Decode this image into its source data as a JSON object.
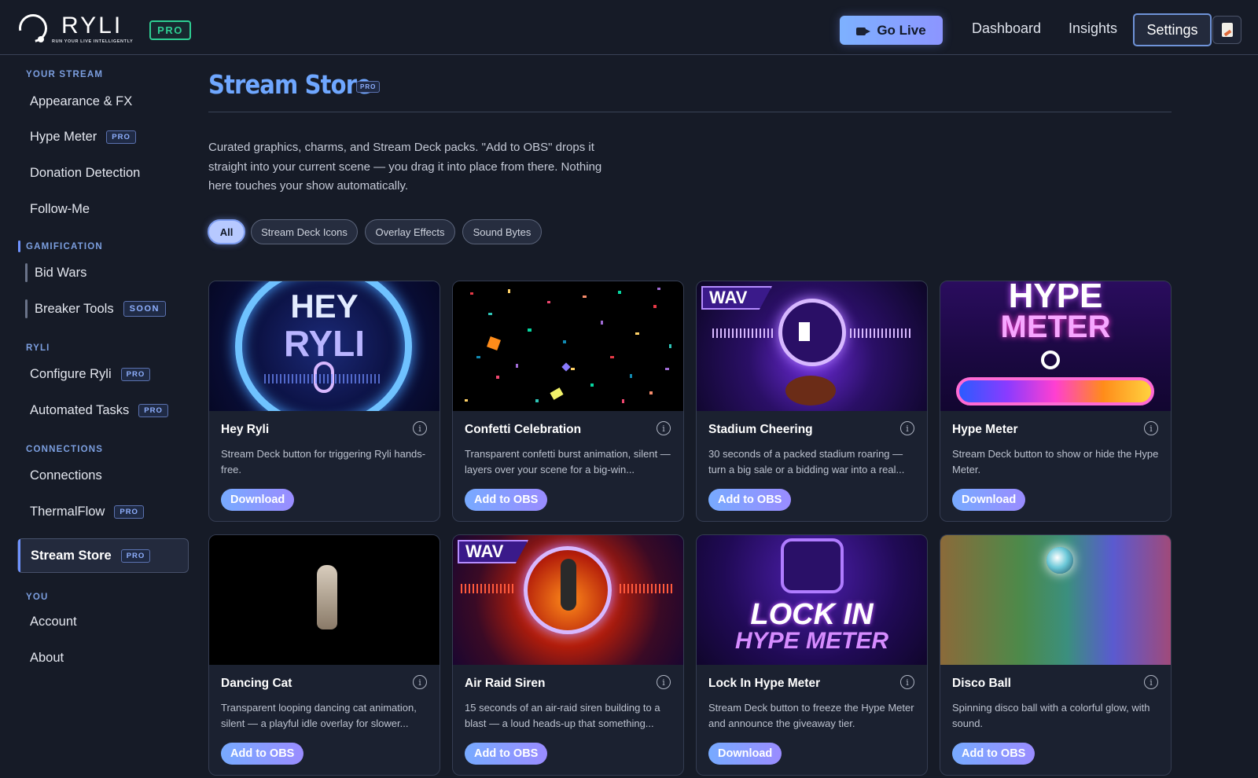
{
  "brand": {
    "name": "RYLI",
    "tagline": "RUN YOUR LIVE INTELLIGENTLY",
    "plan_badge": "PRO"
  },
  "header": {
    "go_live_label": "Go Live",
    "nav": {
      "dashboard": "Dashboard",
      "insights": "Insights",
      "settings": "Settings"
    },
    "accent_color": "#7db1ff"
  },
  "sidebar": {
    "sections": {
      "your_stream": "YOUR STREAM",
      "gamification": "GAMIFICATION",
      "ryli": "RYLI",
      "connections": "CONNECTIONS",
      "you": "YOU"
    },
    "items": {
      "appearance": "Appearance & FX",
      "hype_meter": "Hype Meter",
      "donation_detection": "Donation Detection",
      "follow_me": "Follow-Me",
      "bid_wars": "Bid Wars",
      "breaker_tools": "Breaker Tools",
      "configure_ryli": "Configure Ryli",
      "automated_tasks": "Automated Tasks",
      "connections": "Connections",
      "thermalflow": "ThermalFlow",
      "stream_store": "Stream Store",
      "account": "Account",
      "about": "About"
    },
    "badges": {
      "pro": "PRO",
      "soon": "SOON"
    },
    "active_item": "Stream Store"
  },
  "main": {
    "title": "Stream Store",
    "title_badge": "PRO",
    "intro": "Curated graphics, charms, and Stream Deck packs. \"Add to OBS\" drops it straight into your current scene — you drag it into place from there. Nothing here touches your show automatically.",
    "filters": [
      "All",
      "Stream Deck Icons",
      "Overlay Effects",
      "Sound Bytes"
    ],
    "active_filter": "All",
    "cards": [
      {
        "title": "Hey Ryli",
        "desc": "Stream Deck button for triggering Ryli hands-free.",
        "action": "Download",
        "art_text_1": "HEY",
        "art_text_2": "RYLI"
      },
      {
        "title": "Confetti Celebration",
        "desc": "Transparent confetti burst animation, silent — layers over your scene for a big-win...",
        "action": "Add to OBS"
      },
      {
        "title": "Stadium Cheering",
        "desc": "30 seconds of a packed stadium roaring — turn a big sale or a bidding war into a real...",
        "action": "Add to OBS",
        "art_tag": "WAV"
      },
      {
        "title": "Hype Meter",
        "desc": "Stream Deck button to show or hide the Hype Meter.",
        "action": "Download",
        "art_text_1": "HYPE",
        "art_text_2": "METER"
      },
      {
        "title": "Dancing Cat",
        "desc": "Transparent looping dancing cat animation, silent — a playful idle overlay for slower...",
        "action": "Add to OBS"
      },
      {
        "title": "Air Raid Siren",
        "desc": "15 seconds of an air-raid siren building to a blast — a loud heads-up that something...",
        "action": "Add to OBS",
        "art_tag": "WAV"
      },
      {
        "title": "Lock In Hype Meter",
        "desc": "Stream Deck button to freeze the Hype Meter and announce the giveaway tier.",
        "action": "Download",
        "art_text_1": "LOCK IN",
        "art_text_2": "HYPE METER"
      },
      {
        "title": "Disco Ball",
        "desc": "Spinning disco ball with a colorful glow, with sound.",
        "action": "Add to OBS"
      }
    ],
    "info_glyph": "i"
  },
  "icons": {
    "go_live": "video-camera-icon",
    "doc": "document-icon",
    "info": "info-circle-icon"
  }
}
